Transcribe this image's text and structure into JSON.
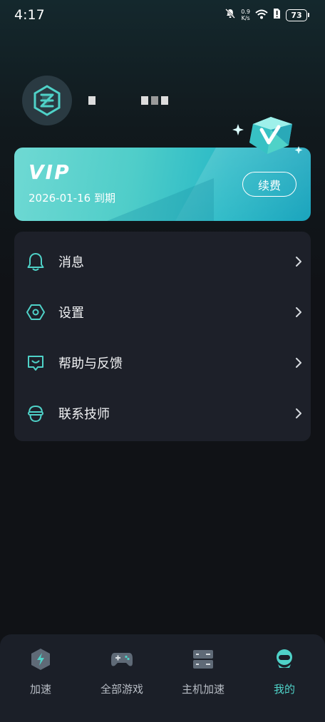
{
  "status_bar": {
    "time": "4:17",
    "net_speed_value": "0.9",
    "net_speed_unit": "K/s",
    "battery": "73"
  },
  "profile": {
    "username_masked": ""
  },
  "vip": {
    "title": "VIP",
    "expiry": "2026-01-16 到期",
    "renew_label": "续费"
  },
  "menu": {
    "items": [
      {
        "label": "消息",
        "icon": "bell-icon"
      },
      {
        "label": "设置",
        "icon": "settings-hex-icon"
      },
      {
        "label": "帮助与反馈",
        "icon": "feedback-chat-icon"
      },
      {
        "label": "联系技师",
        "icon": "technician-icon"
      }
    ]
  },
  "bottom_nav": {
    "items": [
      {
        "label": "加速",
        "icon": "lightning-shield-icon"
      },
      {
        "label": "全部游戏",
        "icon": "gamepad-icon"
      },
      {
        "label": "主机加速",
        "icon": "console-host-icon"
      },
      {
        "label": "我的",
        "icon": "profile-robot-icon",
        "active": true
      }
    ]
  },
  "colors": {
    "accent": "#4fd2c8",
    "card_bg": "#1d2029",
    "background": "#101216",
    "vip_gradient_start": "#6fd9d3",
    "vip_gradient_end": "#1aa4bd"
  }
}
